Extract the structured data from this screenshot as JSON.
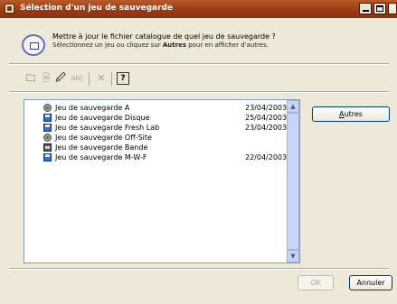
{
  "window": {
    "title": "Sélection d'un jeu de sauvegarde",
    "close_glyph": "✕"
  },
  "header": {
    "icon": "catalog-icon",
    "line1": "Mettre à jour le fichier catalogue de quel jeu de sauvegarde ?",
    "line2_before": "Sélectionnez un jeu ou cliquez sur ",
    "line2_bold": "Autres",
    "line2_after": " pour en afficher d'autres."
  },
  "toolbar": [
    {
      "name": "new-folder-icon",
      "glyph": "🗀",
      "enabled": true
    },
    {
      "name": "properties-icon",
      "glyph": "🗎",
      "enabled": false
    },
    {
      "name": "edit-icon",
      "glyph": "🖉",
      "enabled": true
    },
    {
      "name": "rename-icon",
      "glyph": "ab|",
      "enabled": false
    },
    {
      "name": "delete-icon",
      "glyph": "✕",
      "enabled": false
    },
    {
      "name": "help-icon",
      "glyph": "?",
      "enabled": true
    }
  ],
  "backup_sets": [
    {
      "name": "Jeu de sauvegarde A",
      "date": "23/04/2003",
      "icon": "network-icon"
    },
    {
      "name": "Jeu de sauvegarde Disque",
      "date": "25/04/2003",
      "icon": "disk-icon"
    },
    {
      "name": "Jeu de sauvegarde Fresh Lab",
      "date": "23/04/2003",
      "icon": "disk-icon"
    },
    {
      "name": "Jeu de sauvegarde Off-Site",
      "date": "",
      "icon": "network-icon"
    },
    {
      "name": "Jeu de sauvegarde Bande",
      "date": "",
      "icon": "tape-icon"
    },
    {
      "name": "Jeu de sauvegarde M-W-F",
      "date": "22/04/2003",
      "icon": "disk-icon"
    }
  ],
  "buttons": {
    "other_underlined": "A",
    "other_rest": "utres",
    "ok": "OK",
    "cancel": "Annuler"
  },
  "scrollbar": {
    "up": "▲",
    "down": "▼"
  }
}
